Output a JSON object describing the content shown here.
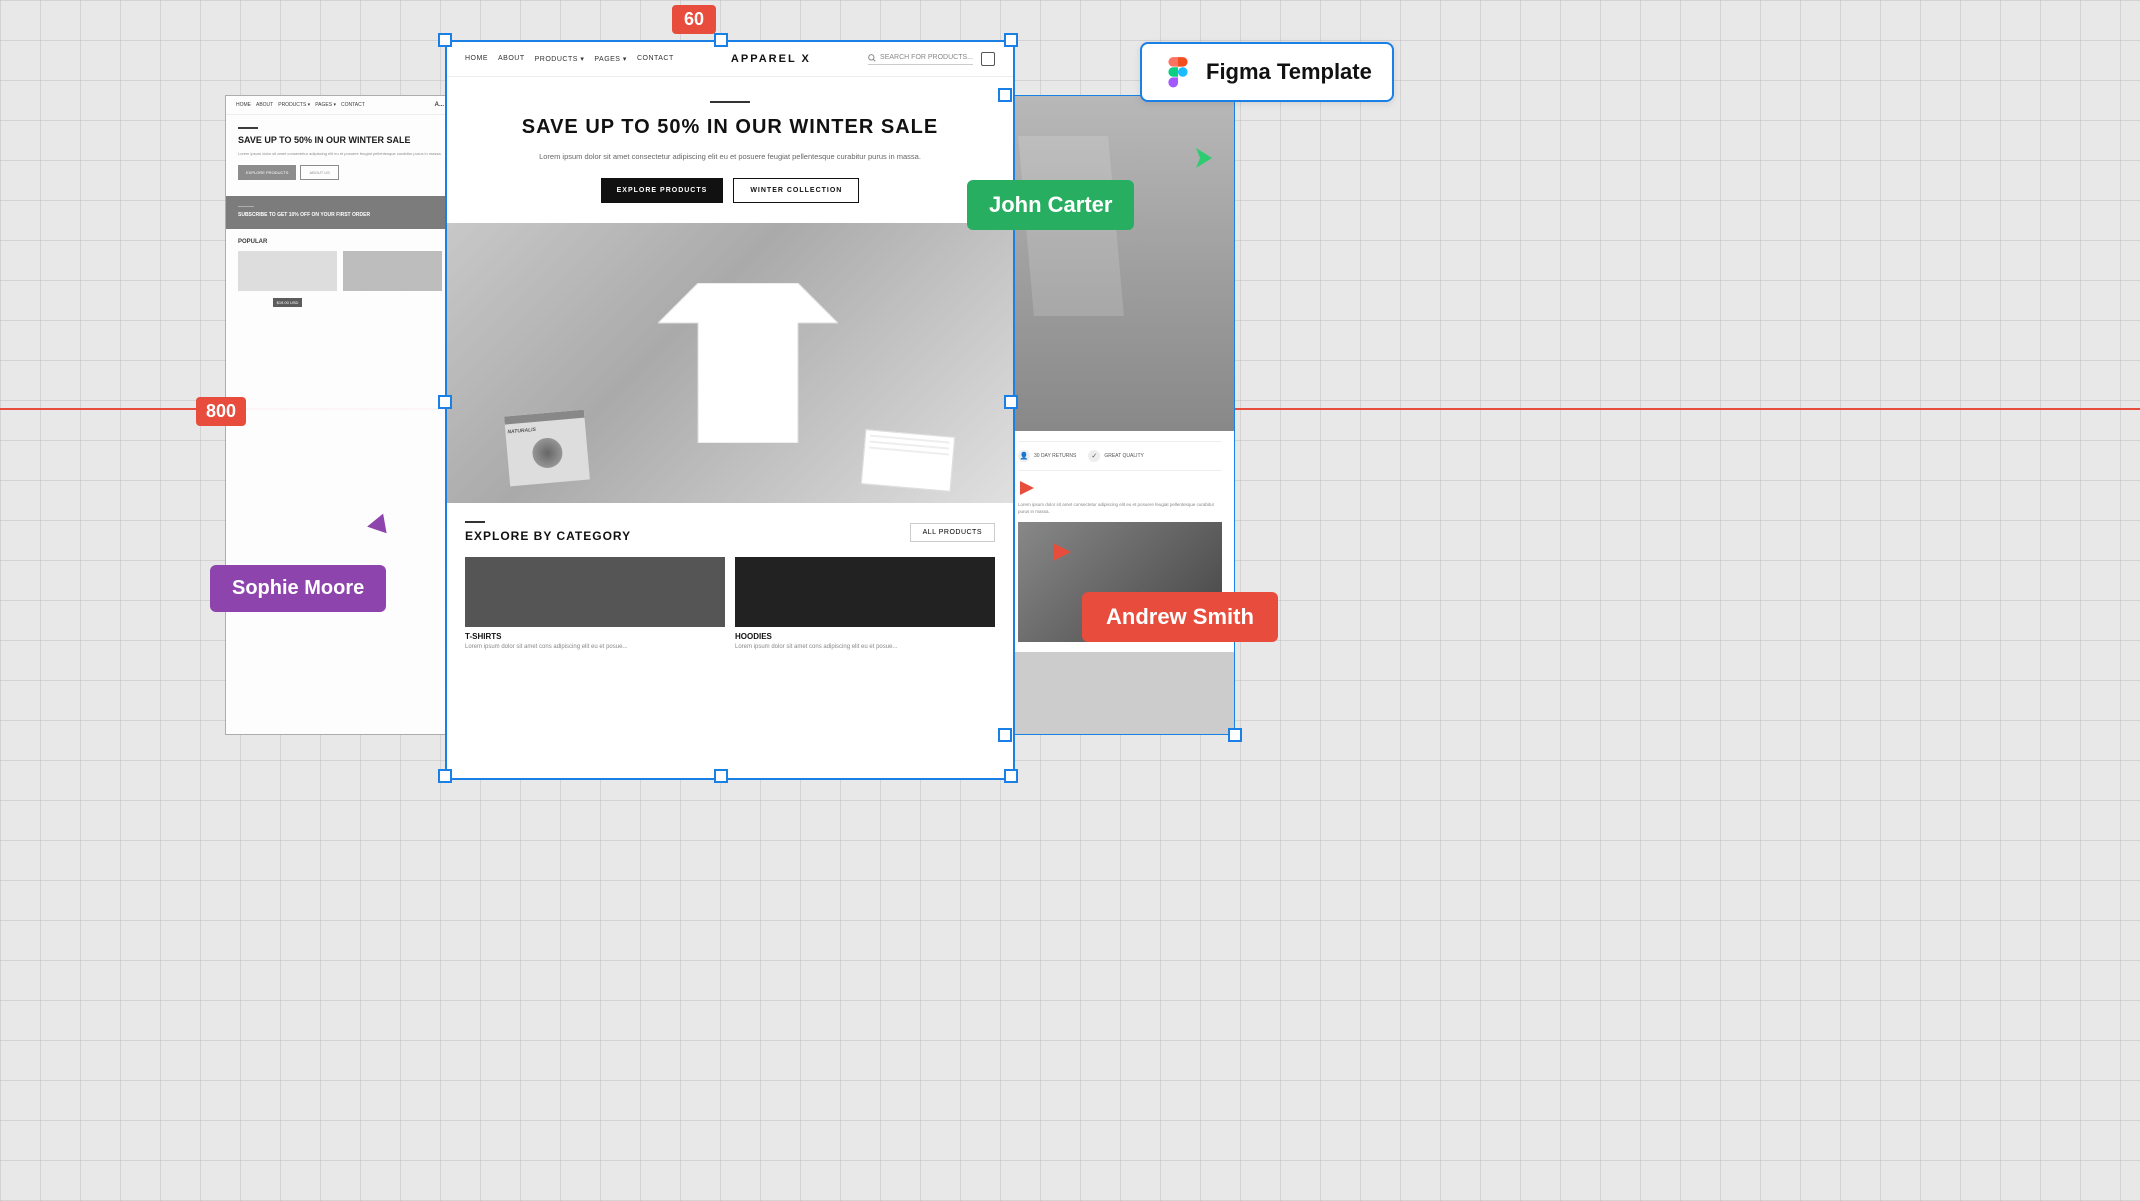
{
  "ruler": {
    "vertical_label": "60",
    "horizontal_label": "800"
  },
  "figma_label": {
    "text": "Figma Template",
    "icon": "figma-icon"
  },
  "user_tags": {
    "sophie": "Sophie Moore",
    "john": "John Carter",
    "andrew": "Andrew Smith"
  },
  "main_frame": {
    "nav": {
      "links": [
        "HOME",
        "ABOUT",
        "PRODUCTS ▾",
        "PAGES ▾",
        "CONTACT"
      ],
      "logo": "APPAREL X",
      "search_placeholder": "SEARCH FOR PRODUCTS...",
      "cart_label": "cart"
    },
    "hero": {
      "heading": "SAVE UP TO 50% IN OUR WINTER SALE",
      "description": "Lorem ipsum dolor sit amet consectetur adipiscing elit eu et posuere feugiat pellentesque curabitur purus in massa.",
      "btn_explore": "EXPLORE PRODUCTS",
      "btn_collection": "WINTER COLLECTION"
    },
    "explore": {
      "title": "EXPLORE BY CATEGORY",
      "all_btn": "ALL PRODUCTS",
      "categories": [
        {
          "name": "T-SHIRTS",
          "desc": "Lorem ipsum dolor sit amet cons adipiscing elit eu et posue..."
        },
        {
          "name": "HOODIES",
          "desc": "Lorem ipsum dolor sit amet cons adipiscing elit eu et posue..."
        }
      ]
    }
  },
  "left_frame": {
    "nav_links": [
      "HOME",
      "ABOUT",
      "PRODUCTS ▾",
      "PAGES ▾",
      "CONTACT",
      "A..."
    ],
    "hero": {
      "heading": "SAVE UP TO 50% IN OUR WINTER SALE",
      "desc": "Lorem ipsum dolor sit amet consectetur adipiscing elit eu et posuere feugiat pellentesque curabitur purus in massa.",
      "btn1": "EXPLORE PRODUCTS",
      "btn2": "ABOUT US"
    },
    "subscribe": {
      "text": "SUBSCRIBE TO GET 10% OFF ON YOUR FIRST ORDER"
    },
    "popular_label": "POPULAR",
    "price": "$19.00 USD"
  },
  "right_frame": {
    "features": [
      "30 DAY RETURNS",
      "GREAT QUALITY"
    ],
    "description": "Lorem ipsum dolor sit amet consectetur adipiscing elit eu et posuere feugiat pellentesque curabitur purus in massa."
  }
}
